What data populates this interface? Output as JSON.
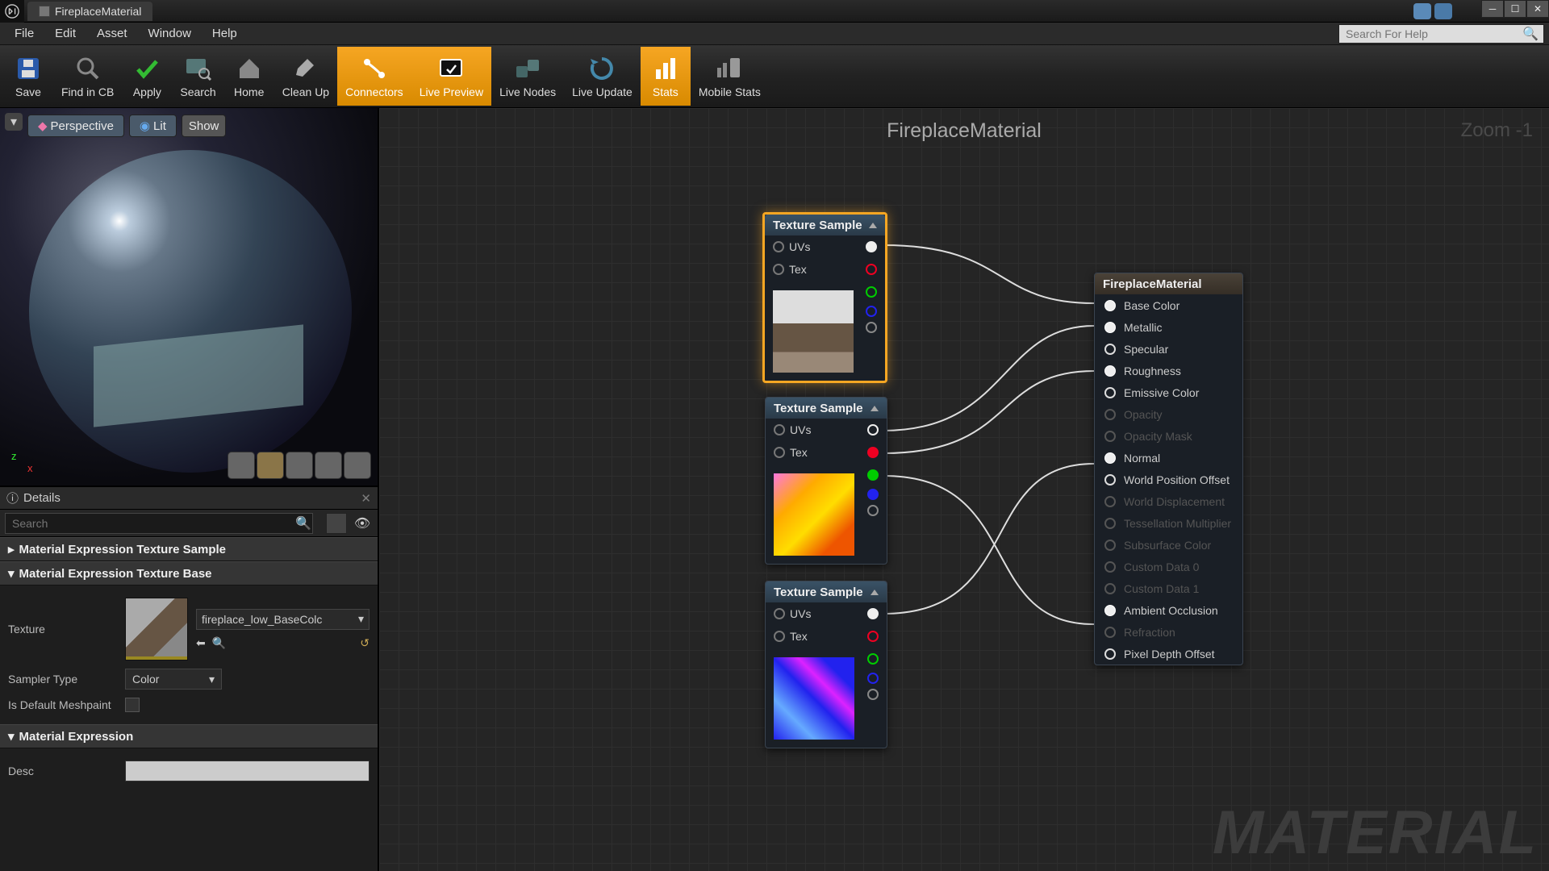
{
  "window": {
    "title": "FireplaceMaterial"
  },
  "menus": [
    "File",
    "Edit",
    "Asset",
    "Window",
    "Help"
  ],
  "help_search_placeholder": "Search For Help",
  "toolbar": [
    {
      "label": "Save",
      "active": false
    },
    {
      "label": "Find in CB",
      "active": false
    },
    {
      "label": "Apply",
      "active": false
    },
    {
      "label": "Search",
      "active": false
    },
    {
      "label": "Home",
      "active": false
    },
    {
      "label": "Clean Up",
      "active": false
    },
    {
      "label": "Connectors",
      "active": true
    },
    {
      "label": "Live Preview",
      "active": true
    },
    {
      "label": "Live Nodes",
      "active": false
    },
    {
      "label": "Live Update",
      "active": false
    },
    {
      "label": "Stats",
      "active": true
    },
    {
      "label": "Mobile Stats",
      "active": false
    }
  ],
  "preview": {
    "buttons": [
      "Perspective",
      "Lit",
      "Show"
    ]
  },
  "details": {
    "tab": "Details",
    "search_placeholder": "Search",
    "sections": {
      "s1": "Material Expression Texture Sample",
      "s2": "Material Expression Texture Base",
      "s3": "Material Expression"
    },
    "texture_label": "Texture",
    "texture_name": "fireplace_low_BaseColc",
    "sampler_label": "Sampler Type",
    "sampler_value": "Color",
    "meshpaint_label": "Is Default Meshpaint",
    "desc_label": "Desc"
  },
  "graph": {
    "title": "FireplaceMaterial",
    "zoom": "Zoom -1",
    "watermark": "MATERIAL",
    "texture_sample": "Texture Sample",
    "node_inputs": [
      "UVs",
      "Tex"
    ],
    "material_node": "FireplaceMaterial",
    "material_pins": [
      {
        "label": "Base Color",
        "type": "fill",
        "enabled": true
      },
      {
        "label": "Metallic",
        "type": "fill",
        "enabled": true
      },
      {
        "label": "Specular",
        "type": "ring",
        "enabled": true
      },
      {
        "label": "Roughness",
        "type": "fill",
        "enabled": true
      },
      {
        "label": "Emissive Color",
        "type": "ring",
        "enabled": true
      },
      {
        "label": "Opacity",
        "type": "ring",
        "enabled": false
      },
      {
        "label": "Opacity Mask",
        "type": "ring",
        "enabled": false
      },
      {
        "label": "Normal",
        "type": "fill",
        "enabled": true
      },
      {
        "label": "World Position Offset",
        "type": "ring",
        "enabled": true
      },
      {
        "label": "World Displacement",
        "type": "ring",
        "enabled": false
      },
      {
        "label": "Tessellation Multiplier",
        "type": "ring",
        "enabled": false
      },
      {
        "label": "Subsurface Color",
        "type": "ring",
        "enabled": false
      },
      {
        "label": "Custom Data 0",
        "type": "ring",
        "enabled": false
      },
      {
        "label": "Custom Data 1",
        "type": "ring",
        "enabled": false
      },
      {
        "label": "Ambient Occlusion",
        "type": "fill",
        "enabled": true
      },
      {
        "label": "Refraction",
        "type": "ring",
        "enabled": false
      },
      {
        "label": "Pixel Depth Offset",
        "type": "ring",
        "enabled": true
      }
    ]
  }
}
